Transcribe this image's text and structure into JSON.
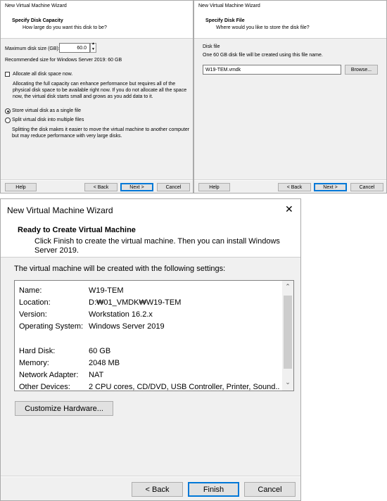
{
  "capacity_dialog": {
    "title": "New Virtual Machine Wizard",
    "heading": "Specify Disk Capacity",
    "subheading": "How large do you want this disk to be?",
    "max_size_label": "Maximum disk size (GB):",
    "max_size_value": "60.0",
    "recommended": "Recommended size for Windows Server 2019: 60 GB",
    "allocate_label": "Allocate all disk space now.",
    "allocate_checked": false,
    "allocate_desc": "Allocating the full capacity can enhance performance but requires all of the physical disk space to be available right now. If you do not allocate all the space now, the virtual disk starts small and grows as you add data to it.",
    "single_label": "Store virtual disk as a single file",
    "multi_label": "Split virtual disk into multiple files",
    "selected": "single",
    "split_desc": "Splitting the disk makes it easier to move the virtual machine to another computer but may reduce performance with very large disks.",
    "buttons": {
      "help": "Help",
      "back": "< Back",
      "next": "Next >",
      "cancel": "Cancel"
    }
  },
  "file_dialog": {
    "title": "New Virtual Machine Wizard",
    "heading": "Specify Disk File",
    "subheading": "Where would you like to store the disk file?",
    "group_label": "Disk file",
    "info": "One 60 GB disk file will be created using this file name.",
    "filename": "W19-TEM.vmdk",
    "browse": "Browse...",
    "buttons": {
      "help": "Help",
      "back": "< Back",
      "next": "Next >",
      "cancel": "Cancel"
    }
  },
  "ready_dialog": {
    "title": "New Virtual Machine Wizard",
    "close_icon": "close-icon",
    "heading": "Ready to Create Virtual Machine",
    "subheading": "Click Finish to create the virtual machine. Then you can install Windows Server 2019.",
    "intro": "The virtual machine will be created with the following settings:",
    "settings": [
      {
        "label": "Name:",
        "value": "W19-TEM"
      },
      {
        "label": "Location:",
        "value": "D:₩01_VMDK₩W19-TEM"
      },
      {
        "label": "Version:",
        "value": "Workstation 16.2.x"
      },
      {
        "label": "Operating System:",
        "value": "Windows Server 2019"
      },
      {
        "label": "",
        "value": ""
      },
      {
        "label": "Hard Disk:",
        "value": "60 GB"
      },
      {
        "label": "Memory:",
        "value": "2048 MB"
      },
      {
        "label": "Network Adapter:",
        "value": "NAT"
      },
      {
        "label": "Other Devices:",
        "value": "2 CPU cores, CD/DVD, USB Controller, Printer, Sound..."
      }
    ],
    "customize": "Customize Hardware...",
    "buttons": {
      "back": "< Back",
      "finish": "Finish",
      "cancel": "Cancel"
    }
  }
}
